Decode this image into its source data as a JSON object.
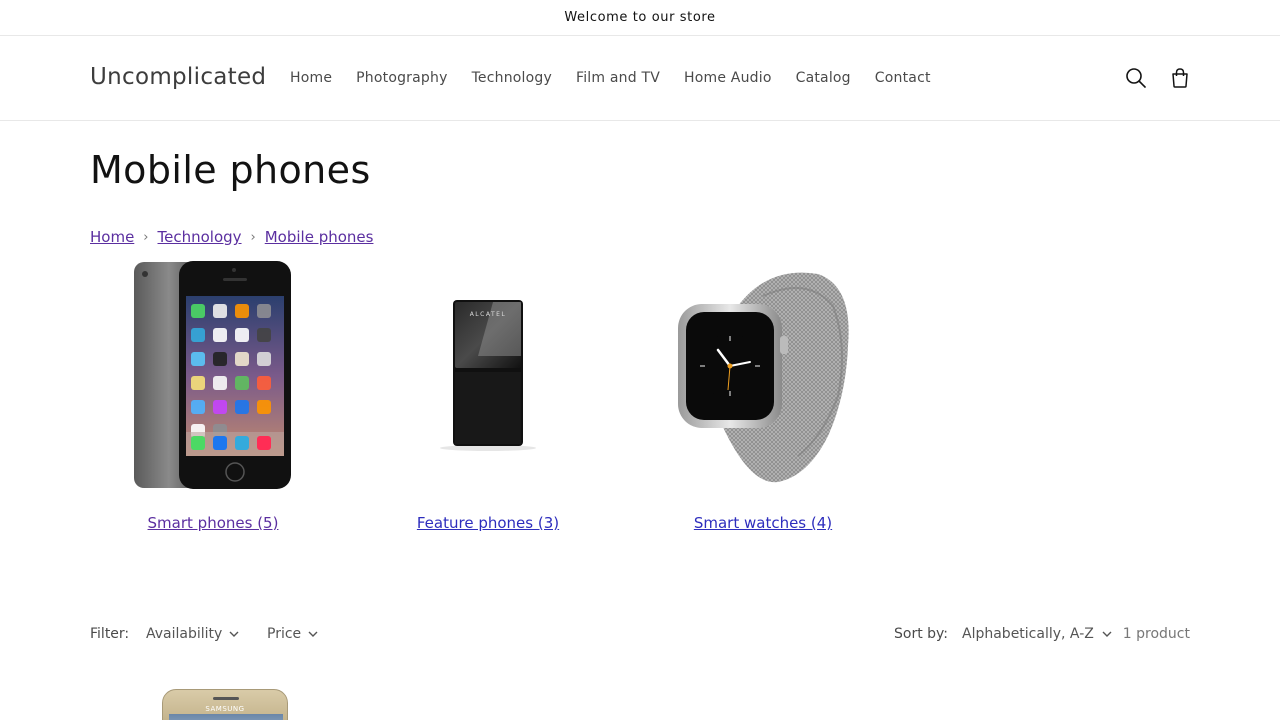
{
  "announcement": {
    "text": "Welcome to our store"
  },
  "header": {
    "logo": "Uncomplicated",
    "nav": [
      "Home",
      "Photography",
      "Technology",
      "Film and TV",
      "Home Audio",
      "Catalog",
      "Contact"
    ],
    "icons": {
      "search": "search-icon",
      "cart": "cart-icon"
    }
  },
  "page": {
    "title": "Mobile phones"
  },
  "breadcrumb": [
    "Home",
    "Technology",
    "Mobile phones"
  ],
  "collections": [
    {
      "label": "Smart phones (5)",
      "image": "smartphone"
    },
    {
      "label": "Feature phones (3)",
      "image": "feature-phone",
      "brand": "ALCATEL"
    },
    {
      "label": "Smart watches (4)",
      "image": "smart-watch"
    }
  ],
  "filters": {
    "label": "Filter:",
    "availability": "Availability",
    "price": "Price",
    "sort_label": "Sort by:",
    "sort_value": "Alphabetically, A-Z",
    "count": "1 product"
  },
  "product": {
    "brand": "SAMSUNG"
  },
  "colors": {
    "link": "#2d2dbd",
    "visited": "#5b2fa0",
    "text": "#121212"
  }
}
